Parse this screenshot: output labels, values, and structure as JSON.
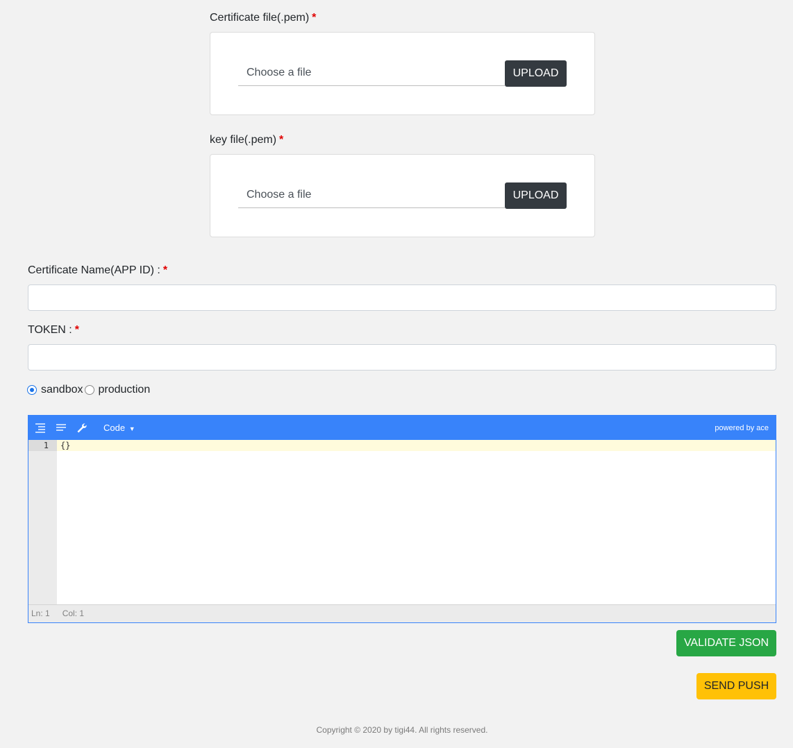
{
  "cert_section": {
    "label": "Certificate file(.pem)",
    "required_mark": "*",
    "file_placeholder": "Choose a file",
    "upload_label": "UPLOAD"
  },
  "key_section": {
    "label": "key file(.pem)",
    "required_mark": "*",
    "file_placeholder": "Choose a file",
    "upload_label": "UPLOAD"
  },
  "cert_name": {
    "label": "Certificate Name(APP ID) :",
    "required_mark": "*",
    "value": ""
  },
  "token": {
    "label": "TOKEN :",
    "required_mark": "*",
    "value": ""
  },
  "environment": {
    "options": [
      "sandbox",
      "production"
    ],
    "selected": "sandbox"
  },
  "editor": {
    "mode_label": "Code",
    "powered_by": "powered by ace",
    "line_numbers": [
      "1"
    ],
    "content": "{}",
    "status_ln": "Ln: 1",
    "status_col": "Col: 1",
    "accent_color": "#3883fa"
  },
  "actions": {
    "validate_label": "VALIDATE JSON",
    "send_label": "SEND PUSH"
  },
  "footer": {
    "copyright": "Copyright © 2020 by tigi44. All rights reserved."
  }
}
